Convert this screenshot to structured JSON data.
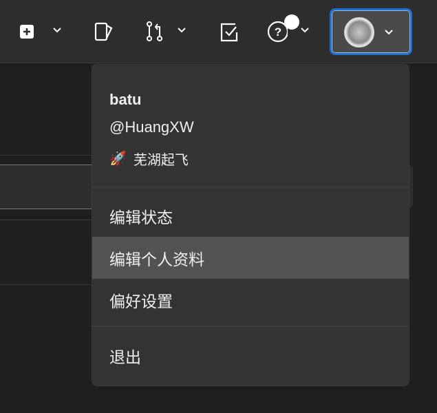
{
  "header": {
    "icons": [
      "plus-square-icon",
      "chevron-down-icon",
      "note-icon",
      "pull-request-icon",
      "chevron-down-icon",
      "checkbox-icon",
      "help-icon",
      "chevron-down-icon",
      "avatar",
      "chevron-down-icon"
    ]
  },
  "menu": {
    "user_name": "batu",
    "user_handle": "@HuangXW",
    "status_emoji": "🚀",
    "status_text": "芜湖起飞",
    "items": [
      {
        "label": "编辑状态"
      },
      {
        "label": "编辑个人资料"
      },
      {
        "label": "偏好设置"
      }
    ],
    "signout": "退出"
  },
  "colors": {
    "accent": "#1e6fd0",
    "menu_bg": "#333333",
    "highlight": "#525252"
  }
}
